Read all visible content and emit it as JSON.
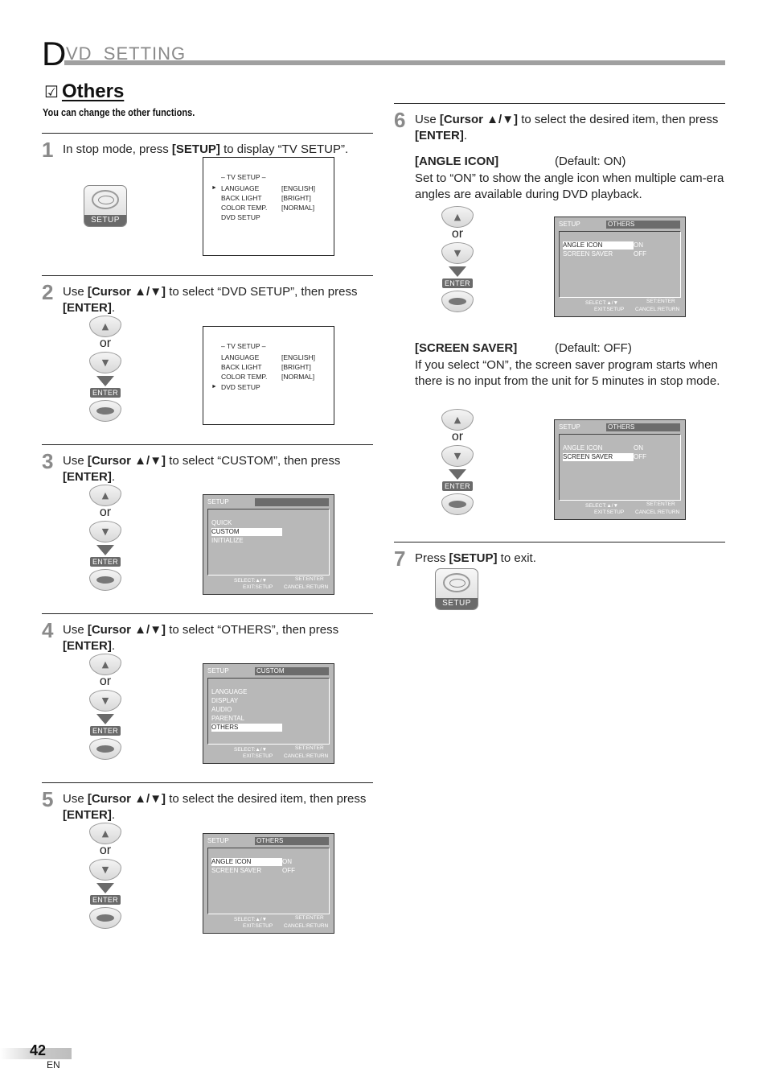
{
  "header": {
    "title_initial": "D",
    "title_rest": "VD  SETTING"
  },
  "section": {
    "checkbox_icon": "☑",
    "title": "Others",
    "subtitle": "You can change the other functions."
  },
  "remote": {
    "or_label": "or",
    "enter_label": "ENTER",
    "setup_label": "SETUP",
    "up_glyph": "▲",
    "down_glyph": "▼"
  },
  "steps": [
    {
      "num": "1",
      "text_html": "In stop mode, press <b>[SETUP]</b> to display “TV SETUP”."
    },
    {
      "num": "2",
      "text_html": "Use <b>[Cursor ▲/▼]</b> to select “DVD SETUP”, then press<br><b>[ENTER]</b>."
    },
    {
      "num": "3",
      "text_html": "Use <b>[Cursor ▲/▼]</b> to select “CUSTOM”, then press<br><b>[ENTER]</b>."
    },
    {
      "num": "4",
      "text_html": "Use <b>[Cursor ▲/▼]</b> to select “OTHERS”, then press<br><b>[ENTER]</b>."
    },
    {
      "num": "5",
      "text_html": "Use <b>[Cursor ▲/▼]</b> to select the desired item, then press<br><b>[ENTER]</b>."
    },
    {
      "num": "6",
      "text_html": "Use <b>[Cursor ▲/▼]</b> to select the desired item, then press<br><b>[ENTER]</b>."
    },
    {
      "num": "7",
      "text_html": "Press <b>[SETUP]</b> to exit."
    }
  ],
  "tv_setup": {
    "title": "– TV SETUP –",
    "cursor": "►",
    "items": [
      {
        "label": "LANGUAGE",
        "value": "[ENGLISH]"
      },
      {
        "label": "BACK LIGHT",
        "value": "[BRIGHT]"
      },
      {
        "label": "COLOR TEMP.",
        "value": "[NORMAL]"
      },
      {
        "label": "DVD SETUP",
        "value": ""
      }
    ]
  },
  "dvd_screen": {
    "top_label": "SETUP",
    "footer": {
      "select": "SELECT:▲/▼",
      "set": "SET:ENTER",
      "exit": "EXIT:SETUP",
      "cancel": "CANCEL:RETURN"
    },
    "setup_menu": {
      "bar": "",
      "items": [
        "QUICK",
        "CUSTOM",
        "INITIALIZE"
      ]
    },
    "custom_menu": {
      "bar": "CUSTOM",
      "items": [
        "LANGUAGE",
        "DISPLAY",
        "AUDIO",
        "PARENTAL",
        "OTHERS"
      ]
    },
    "others_menu": {
      "bar": "OTHERS",
      "items": [
        {
          "label": "ANGLE ICON",
          "value": "ON"
        },
        {
          "label": "SCREEN SAVER",
          "value": "OFF"
        }
      ]
    }
  },
  "angle_icon": {
    "heading": "[ANGLE ICON]",
    "default": "(Default: ON)",
    "desc": "Set to “ON” to show the angle icon when multiple cam-era angles are available during DVD playback."
  },
  "screen_saver": {
    "heading": "[SCREEN SAVER]",
    "default": "(Default: OFF)",
    "desc": "If you select “ON”, the screen saver program starts when there is no input from the unit for 5 minutes in stop mode."
  },
  "footer": {
    "page_number": "42",
    "language": "EN"
  }
}
